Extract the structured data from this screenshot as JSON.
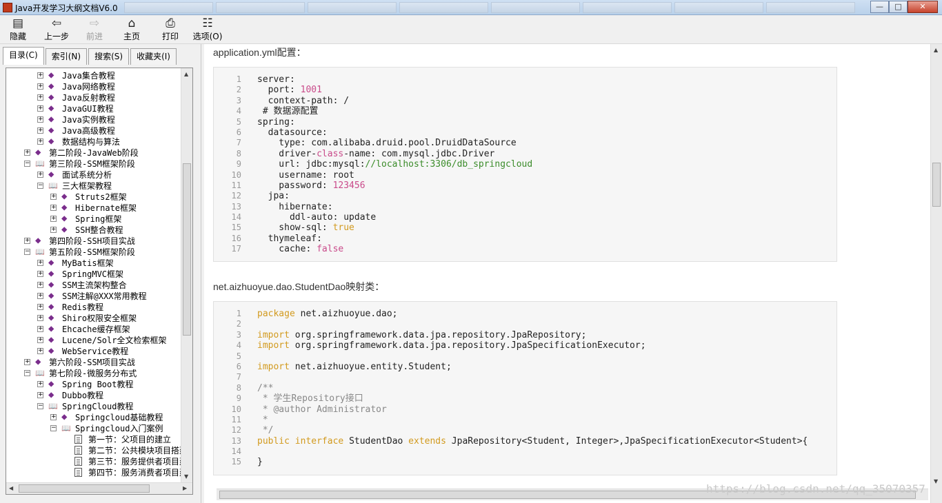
{
  "window": {
    "title": "Java开发学习大纲文档V6.0",
    "min": "—",
    "max": "□",
    "close": "✕"
  },
  "toolbar": {
    "hide": "隐藏",
    "back": "上一步",
    "forward": "前进",
    "home": "主页",
    "print": "打印",
    "options": "选项(O)"
  },
  "tabs": [
    "目录(C)",
    "索引(N)",
    "搜索(S)",
    "收藏夹(I)"
  ],
  "tree": [
    {
      "indent": 1,
      "pm": "+",
      "icon": "book",
      "label": "Java集合教程"
    },
    {
      "indent": 1,
      "pm": "+",
      "icon": "book",
      "label": "Java网络教程"
    },
    {
      "indent": 1,
      "pm": "+",
      "icon": "book",
      "label": "Java反射教程"
    },
    {
      "indent": 1,
      "pm": "+",
      "icon": "book",
      "label": "JavaGUI教程"
    },
    {
      "indent": 1,
      "pm": "+",
      "icon": "book",
      "label": "Java实例教程"
    },
    {
      "indent": 1,
      "pm": "+",
      "icon": "book",
      "label": "Java高级教程"
    },
    {
      "indent": 1,
      "pm": "+",
      "icon": "book",
      "label": "数据结构与算法"
    },
    {
      "indent": 0,
      "pm": "+",
      "icon": "book",
      "label": "第二阶段-JavaWeb阶段"
    },
    {
      "indent": 0,
      "pm": "-",
      "icon": "open",
      "label": "第三阶段-SSM框架阶段"
    },
    {
      "indent": 1,
      "pm": "+",
      "icon": "book",
      "label": "面试系统分析"
    },
    {
      "indent": 1,
      "pm": "-",
      "icon": "open",
      "label": "三大框架教程"
    },
    {
      "indent": 2,
      "pm": "+",
      "icon": "book",
      "label": "Struts2框架"
    },
    {
      "indent": 2,
      "pm": "+",
      "icon": "book",
      "label": "Hibernate框架"
    },
    {
      "indent": 2,
      "pm": "+",
      "icon": "book",
      "label": "Spring框架"
    },
    {
      "indent": 2,
      "pm": "+",
      "icon": "book",
      "label": "SSH整合教程"
    },
    {
      "indent": 0,
      "pm": "+",
      "icon": "book",
      "label": "第四阶段-SSH项目实战"
    },
    {
      "indent": 0,
      "pm": "-",
      "icon": "open",
      "label": "第五阶段-SSM框架阶段"
    },
    {
      "indent": 1,
      "pm": "+",
      "icon": "book",
      "label": "MyBatis框架"
    },
    {
      "indent": 1,
      "pm": "+",
      "icon": "book",
      "label": "SpringMVC框架"
    },
    {
      "indent": 1,
      "pm": "+",
      "icon": "book",
      "label": "SSM主流架构整合"
    },
    {
      "indent": 1,
      "pm": "+",
      "icon": "book",
      "label": "SSM注解@XXX常用教程"
    },
    {
      "indent": 1,
      "pm": "+",
      "icon": "book",
      "label": "Redis教程"
    },
    {
      "indent": 1,
      "pm": "+",
      "icon": "book",
      "label": "Shiro权限安全框架"
    },
    {
      "indent": 1,
      "pm": "+",
      "icon": "book",
      "label": "Ehcache缓存框架"
    },
    {
      "indent": 1,
      "pm": "+",
      "icon": "book",
      "label": "Lucene/Solr全文检索框架"
    },
    {
      "indent": 1,
      "pm": "+",
      "icon": "book",
      "label": "WebService教程"
    },
    {
      "indent": 0,
      "pm": "+",
      "icon": "book",
      "label": "第六阶段-SSM项目实战"
    },
    {
      "indent": 0,
      "pm": "-",
      "icon": "open",
      "label": "第七阶段-微服务分布式"
    },
    {
      "indent": 1,
      "pm": "+",
      "icon": "book",
      "label": "Spring Boot教程"
    },
    {
      "indent": 1,
      "pm": "+",
      "icon": "book",
      "label": "Dubbo教程"
    },
    {
      "indent": 1,
      "pm": "-",
      "icon": "open",
      "label": "SpringCloud教程"
    },
    {
      "indent": 2,
      "pm": "+",
      "icon": "book",
      "label": "Springcloud基础教程"
    },
    {
      "indent": 2,
      "pm": "-",
      "icon": "open",
      "label": "Springcloud入门案例"
    },
    {
      "indent": 3,
      "pm": "",
      "icon": "page",
      "label": "第一节：父项目的建立"
    },
    {
      "indent": 3,
      "pm": "",
      "icon": "page",
      "label": "第二节：公共模块项目搭建"
    },
    {
      "indent": 3,
      "pm": "",
      "icon": "page",
      "label": "第三节：服务提供者项目建立"
    },
    {
      "indent": 3,
      "pm": "",
      "icon": "page",
      "label": "第四节：服务消费者项目建立"
    }
  ],
  "content": {
    "heading1": "application.yml配置：",
    "heading2": "net.aizhuoyue.dao.StudentDao映射类：",
    "code1": [
      [
        {
          "t": "server:"
        }
      ],
      [
        {
          "t": "  port: "
        },
        {
          "t": "1001",
          "c": "kw"
        }
      ],
      [
        {
          "t": "  context-path: /"
        }
      ],
      [
        {
          "t": " # 数据源配置"
        }
      ],
      [
        {
          "t": "spring:"
        }
      ],
      [
        {
          "t": "  datasource:"
        }
      ],
      [
        {
          "t": "    type: com.alibaba.druid.pool.DruidDataSource"
        }
      ],
      [
        {
          "t": "    driver-"
        },
        {
          "t": "class",
          "c": "kw"
        },
        {
          "t": "-name: com.mysql.jdbc.Driver"
        }
      ],
      [
        {
          "t": "    url: jdbc:mysql:"
        },
        {
          "t": "//localhost:3306/db_springcloud",
          "c": "grn"
        }
      ],
      [
        {
          "t": "    username: root"
        }
      ],
      [
        {
          "t": "    password: "
        },
        {
          "t": "123456",
          "c": "kw"
        }
      ],
      [
        {
          "t": "  jpa:"
        }
      ],
      [
        {
          "t": "    hibernate:"
        }
      ],
      [
        {
          "t": "      ddl-auto: update"
        }
      ],
      [
        {
          "t": "    show-sql: "
        },
        {
          "t": "true",
          "c": "kw2"
        }
      ],
      [
        {
          "t": "  thymeleaf:"
        }
      ],
      [
        {
          "t": "    cache: "
        },
        {
          "t": "false",
          "c": "kw"
        }
      ]
    ],
    "code2": [
      [
        {
          "t": "package",
          "c": "kw2"
        },
        {
          "t": " net.aizhuoyue.dao;"
        }
      ],
      [
        {
          "t": ""
        }
      ],
      [
        {
          "t": "import",
          "c": "kw2"
        },
        {
          "t": " org.springframework.data.jpa.repository.JpaRepository;"
        }
      ],
      [
        {
          "t": "import",
          "c": "kw2"
        },
        {
          "t": " org.springframework.data.jpa.repository.JpaSpecificationExecutor;"
        }
      ],
      [
        {
          "t": ""
        }
      ],
      [
        {
          "t": "import",
          "c": "kw2"
        },
        {
          "t": " net.aizhuoyue.entity.Student;"
        }
      ],
      [
        {
          "t": ""
        }
      ],
      [
        {
          "t": "/**",
          "c": "cmt"
        }
      ],
      [
        {
          "t": " * 学生Repository接口",
          "c": "cmt"
        }
      ],
      [
        {
          "t": " * @author Administrator",
          "c": "cmt"
        }
      ],
      [
        {
          "t": " *",
          "c": "cmt"
        }
      ],
      [
        {
          "t": " */",
          "c": "cmt"
        }
      ],
      [
        {
          "t": "public",
          "c": "kw2"
        },
        {
          "t": " "
        },
        {
          "t": "interface",
          "c": "kw2"
        },
        {
          "t": " StudentDao "
        },
        {
          "t": "extends",
          "c": "kw2"
        },
        {
          "t": " JpaRepository<Student, Integer>,JpaSpecificationExecutor<Student>{"
        }
      ],
      [
        {
          "t": ""
        }
      ],
      [
        {
          "t": "}"
        }
      ]
    ]
  },
  "watermark": "https://blog.csdn.net/qq_35070357"
}
